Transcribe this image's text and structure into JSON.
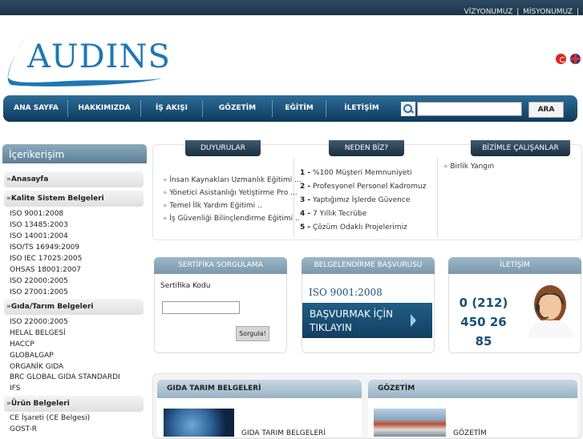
{
  "top_links": [
    "VİZYONUMUZ",
    "|",
    "MİSYONUMUZ",
    "|"
  ],
  "logo_text": "AUDINS",
  "nav": {
    "items": [
      "ANA SAYFA",
      "HAKKIMIZDA",
      "İŞ AKIŞI",
      "GÖZETİM",
      "EĞİTİM",
      "İLETİŞİM"
    ],
    "search_value": "",
    "search_button": "ARA"
  },
  "sidebar": {
    "title": "İçerikerişim",
    "categories": [
      "Anasayfa",
      "Kalite Sistem Belgeleri",
      "Gıda/Tarım Belgeleri",
      "Ürün Belgeleri"
    ],
    "quality_links": [
      "ISO 9001:2008",
      "ISO 13485:2003",
      "ISO 14001:2004",
      "ISO/TS 16949:2009",
      "ISO IEC 17025:2005",
      "OHSAS 18001:2007",
      "ISO 22000:2005",
      "ISO 27001:2005"
    ],
    "food_links": [
      "ISO 22000:2005",
      "HELAL BELGESİ",
      "HACCP",
      "GLOBALGAP",
      "ORGANİK GIDA",
      "BRC GLOBAL GIDA STANDARDI",
      "IFS"
    ],
    "product_links": [
      "CE İşareti (CE Belgesi)",
      "GOST-R"
    ]
  },
  "tabs": [
    "DUYURULAR",
    "NEDEN BİZ?",
    "BİZİMLE ÇALIŞANLAR"
  ],
  "announcements": [
    "İnsan Kaynakları Uzmanlık Eğitimi ...",
    "Yönetici Asistanlığı Yetiştirme Pro ...",
    "Temel İlk Yardım Eğitimi ..",
    "İş Güvenliği Bilinçlendirme Eğitimi .."
  ],
  "why_us": [
    {
      "num": "1 -",
      "text": "%100 Müşteri Memnuniyeti"
    },
    {
      "num": "2 -",
      "text": "Profesyonel Personel Kadromuz"
    },
    {
      "num": "3 -",
      "text": "Yaptığımız İşlerde Güvence"
    },
    {
      "num": "4 -",
      "text": "7 Yıllık Tecrübe"
    },
    {
      "num": "5 -",
      "text": "Çözüm Odaklı Projelerimiz"
    }
  ],
  "clients": [
    "Birlik Yangın"
  ],
  "cert_query": {
    "title": "SERTİFİKA SORGULAMA",
    "label": "Sertifika Kodu",
    "value": "",
    "button": "Sorgula!"
  },
  "apply": {
    "title": "BELGELENDİRME BAŞVURUSU",
    "iso": "ISO 9001:2008",
    "banner_line1": "BAŞVURMAK İÇİN",
    "banner_line2": "TIKLAYIN"
  },
  "contact": {
    "title": "İLETİŞİM",
    "phone_line1": "0 (212)",
    "phone_line2": "450 26 85"
  },
  "bottom": {
    "left_title": "GIDA TARIM BELGELERİ",
    "left_caption": "GIDA TARIM BELGELERİ",
    "right_title": "GÖZETİM",
    "right_caption": "GÖZETİM"
  },
  "colors": {
    "brand_blue": "#1f76b4",
    "nav_dark": "#0e3a5c",
    "accent_text": "#1b4f77"
  }
}
